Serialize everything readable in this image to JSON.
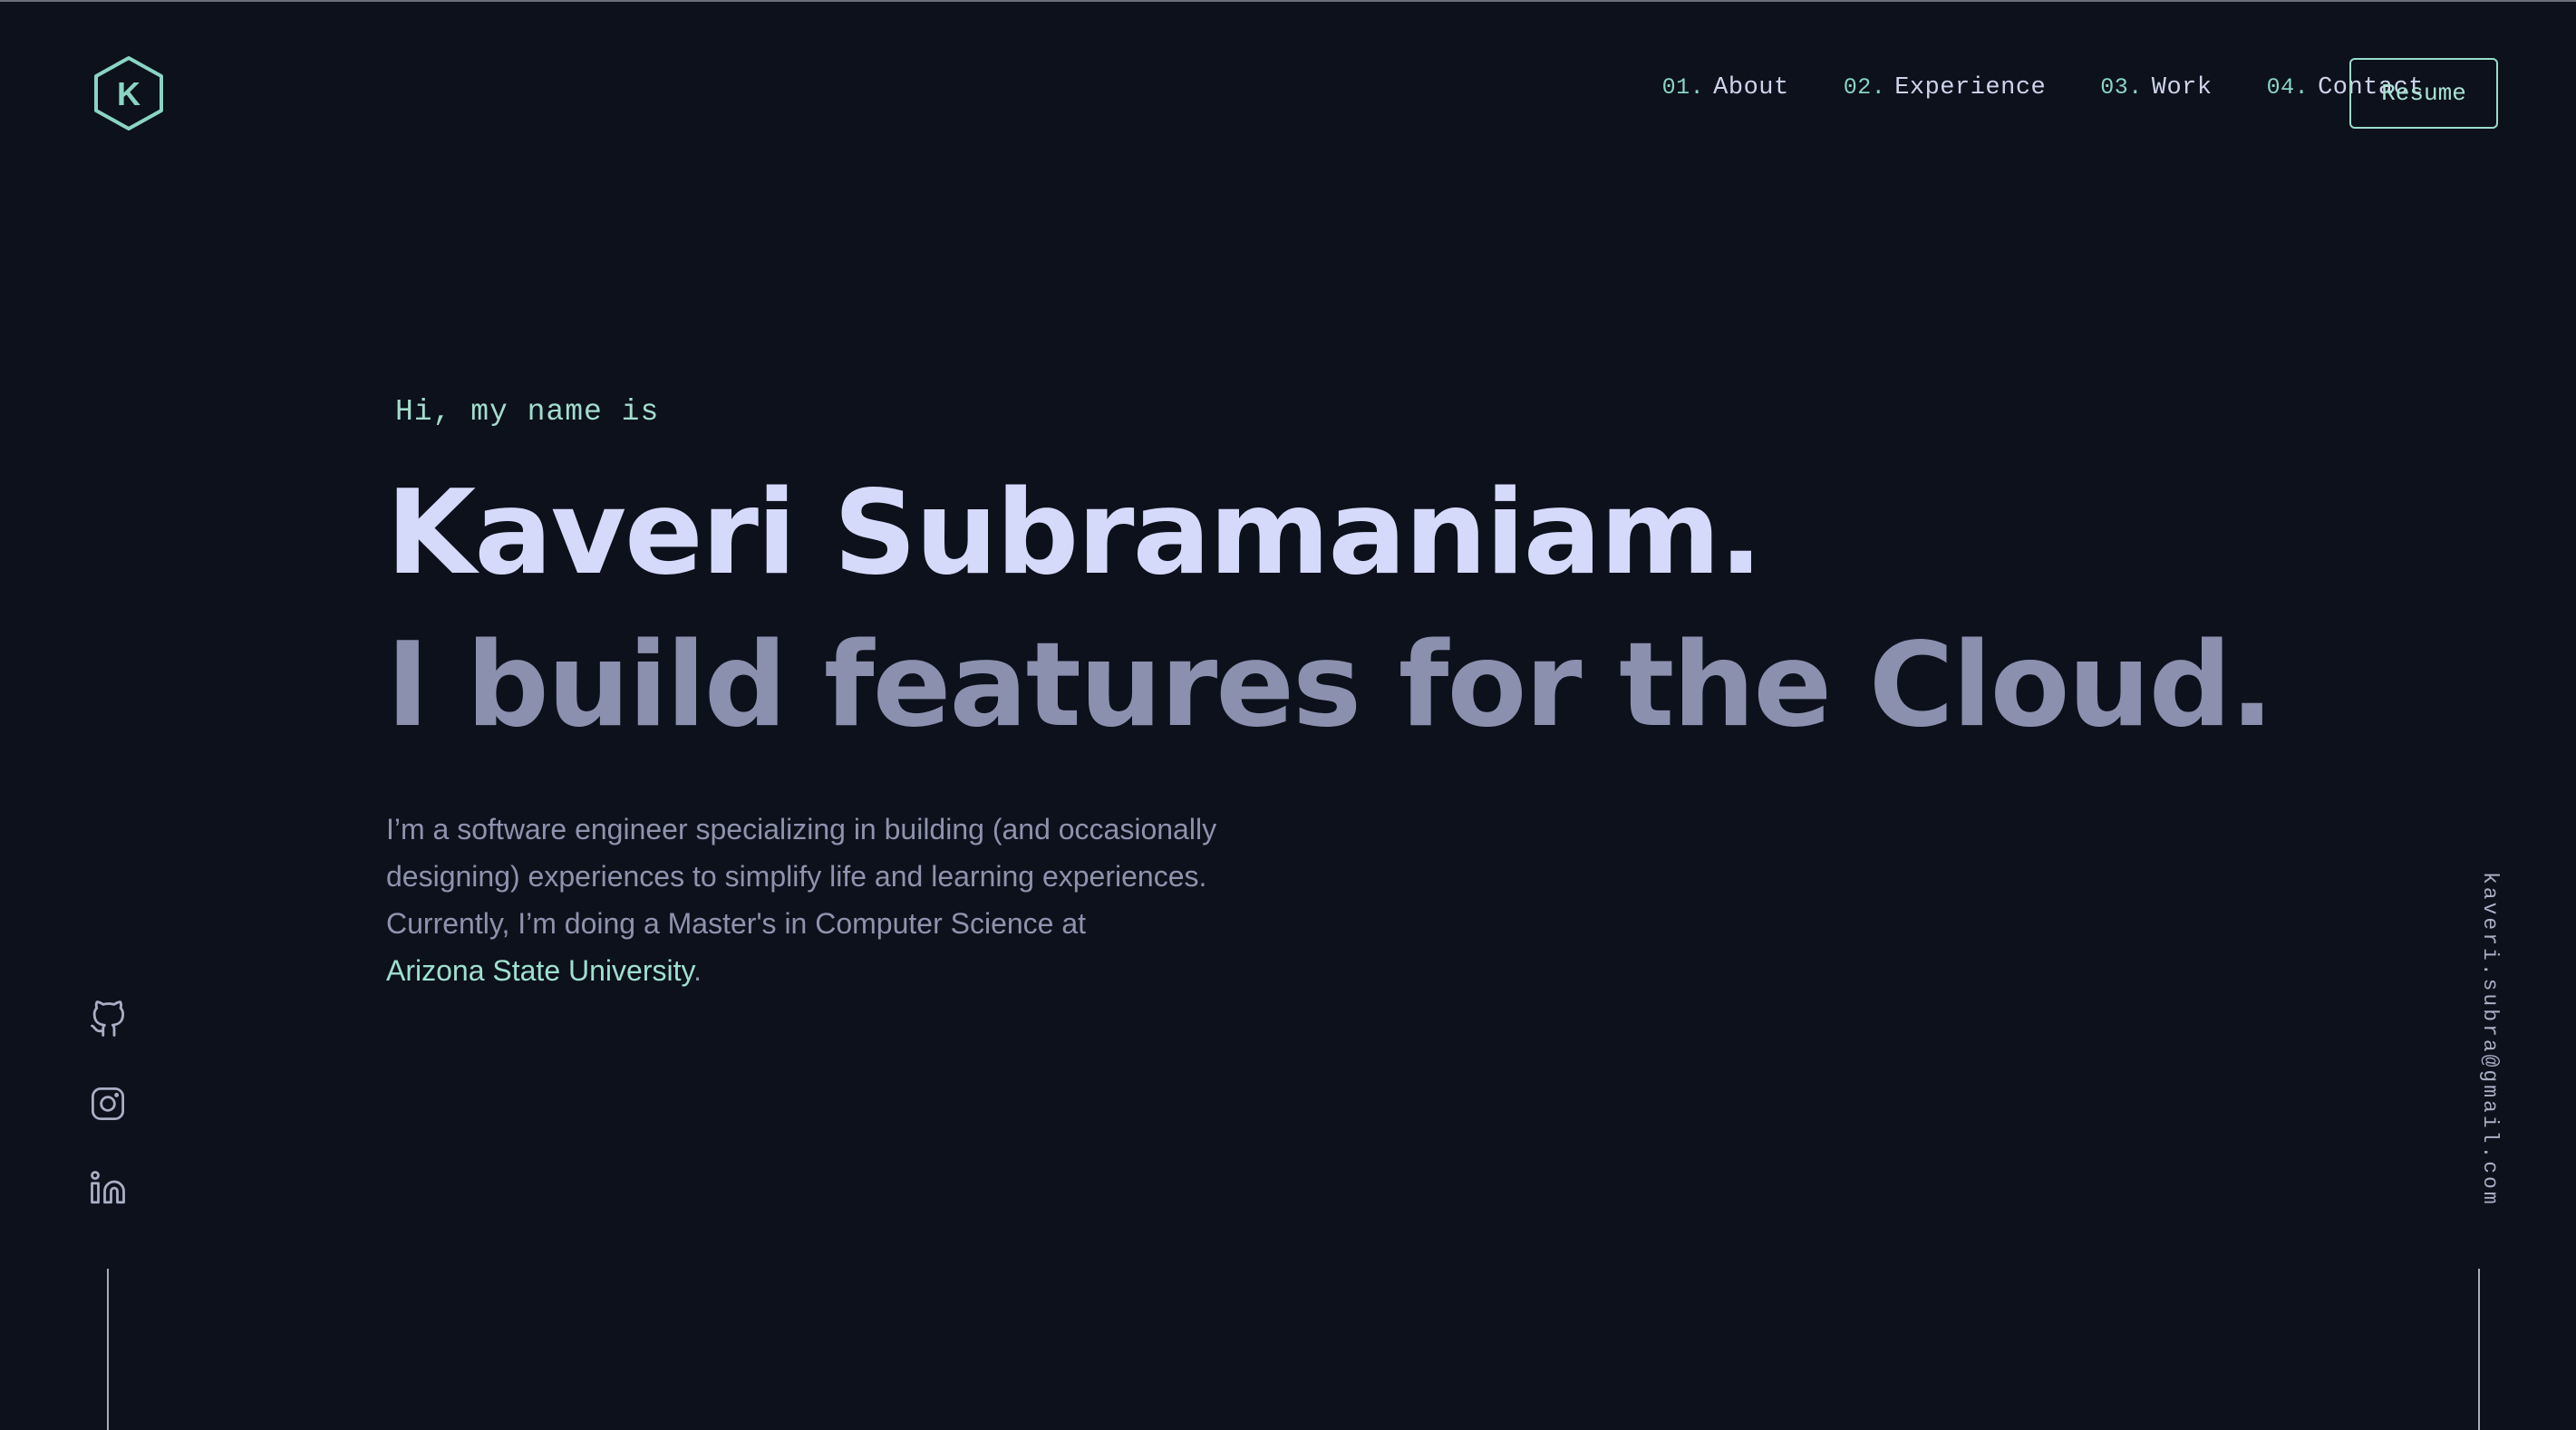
{
  "header": {
    "logo_letter": "K",
    "nav": [
      {
        "num": "01.",
        "label": "About"
      },
      {
        "num": "02.",
        "label": "Experience"
      },
      {
        "num": "03.",
        "label": "Work"
      },
      {
        "num": "04.",
        "label": "Contact"
      }
    ],
    "resume_label": "Resume"
  },
  "hero": {
    "greeting": "Hi, my name is",
    "name": "Kaveri Subramaniam.",
    "tagline": "I build features for the Cloud.",
    "bio_line1": "I’m a software engineer specializing in building (and occasionally",
    "bio_line2": "designing) experiences to simplify life and learning experiences.",
    "bio_line3": "Currently, I’m doing a Master's in Computer Science at",
    "bio_link": "Arizona State University",
    "bio_end": "."
  },
  "social": {
    "icons": [
      "github-icon",
      "instagram-icon",
      "linkedin-icon"
    ]
  },
  "email": "kaveri.subra@gmail.com",
  "colors": {
    "background": "#0c111c",
    "accent": "#9ee0cf",
    "heading": "#d5dafa",
    "subheading": "#8b90ae",
    "body_text": "#8e93ad"
  }
}
